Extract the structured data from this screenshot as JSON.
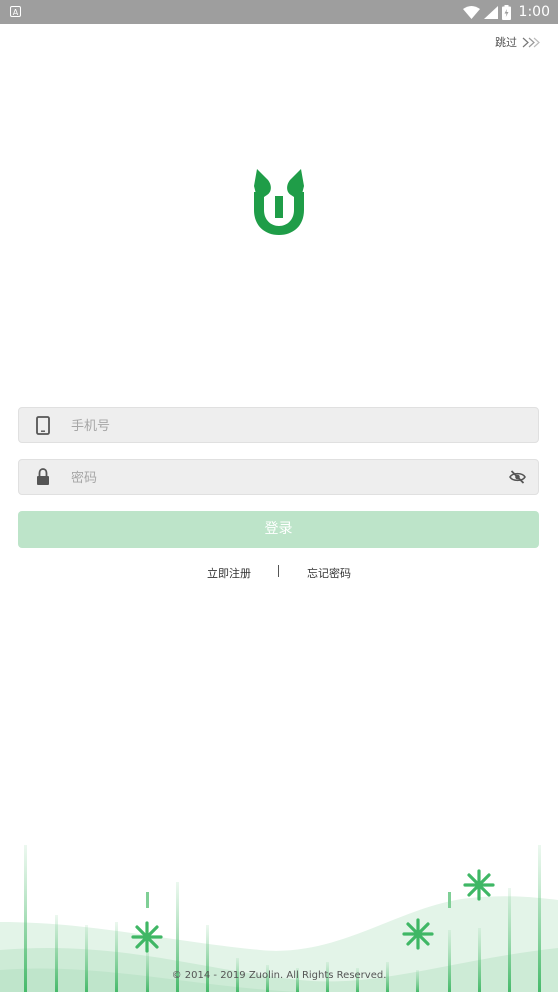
{
  "status_bar": {
    "time": "1:00",
    "notification_icon": "a-icon"
  },
  "header": {
    "skip_label": "跳过"
  },
  "form": {
    "phone_placeholder": "手机号",
    "password_placeholder": "密码",
    "login_label": "登录"
  },
  "links": {
    "register": "立即注册",
    "forgot": "忘记密码"
  },
  "footer": {
    "copyright": "© 2014 - 2019 Zuolin. All Rights Reserved."
  },
  "colors": {
    "brand": "#1f9d48",
    "button_disabled": "#bde4c9",
    "footer_green": "#7fcf96"
  }
}
